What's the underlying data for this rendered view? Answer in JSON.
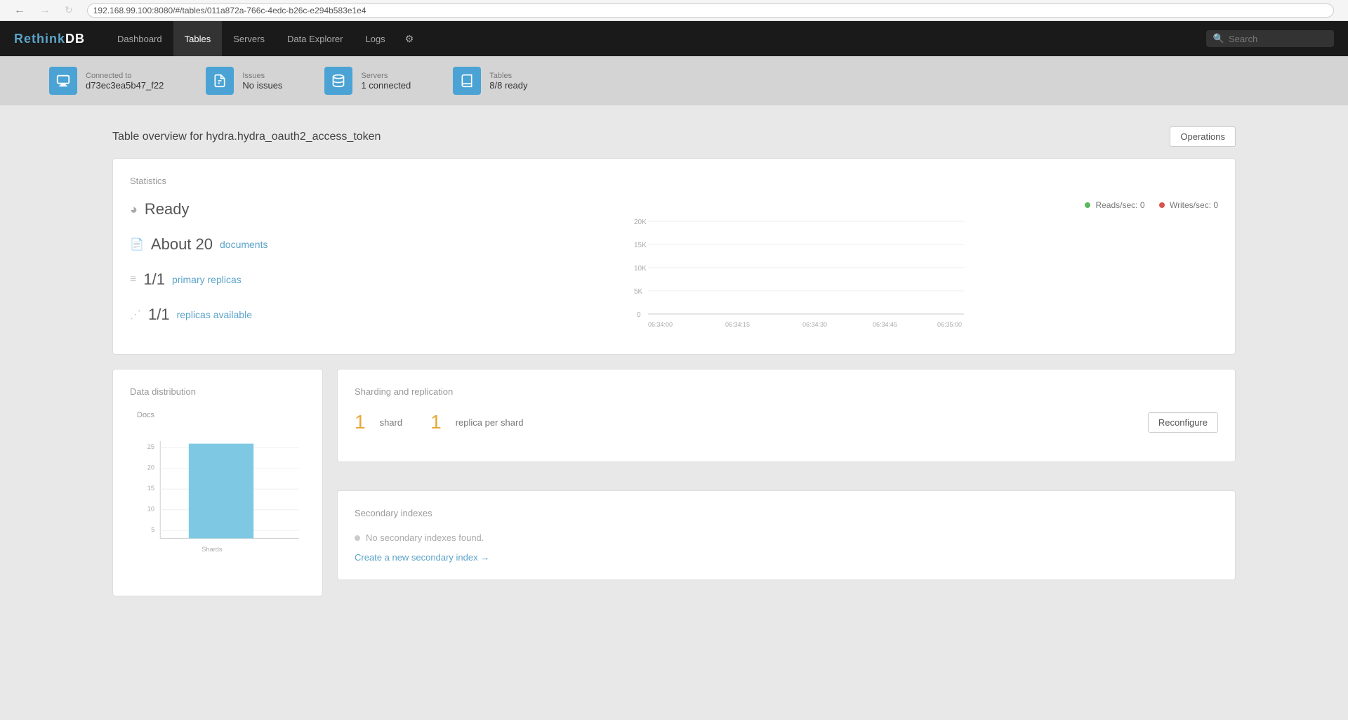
{
  "browser": {
    "url": "192.168.99.100:8080/#/tables/011a872a-766c-4edc-b26c-e294b583e1e4"
  },
  "navbar": {
    "brand": "RethinkDB",
    "links": [
      {
        "label": "Dashboard",
        "active": false
      },
      {
        "label": "Tables",
        "active": true
      },
      {
        "label": "Servers",
        "active": false
      },
      {
        "label": "Data Explorer",
        "active": false
      },
      {
        "label": "Logs",
        "active": false
      }
    ],
    "search_placeholder": "Search"
  },
  "statusbar": {
    "connected_to": {
      "label": "Connected to",
      "value": "d73ec3ea5b47_f22"
    },
    "issues": {
      "label": "Issues",
      "value": "No issues"
    },
    "servers": {
      "label": "Servers",
      "value": "1 connected"
    },
    "tables": {
      "label": "Tables",
      "value": "8/8 ready"
    }
  },
  "page": {
    "title": "Table overview for hydra.hydra_oauth2_access_token",
    "operations_label": "Operations"
  },
  "statistics": {
    "section_title": "Statistics",
    "status": "Ready",
    "documents_count": "About 20",
    "documents_link": "documents",
    "replicas": "1/1",
    "replicas_link": "primary replicas",
    "replicas_available": "1/1",
    "replicas_available_link": "replicas available",
    "chart": {
      "legend_reads": "Reads/sec: 0",
      "legend_writes": "Writes/sec: 0",
      "reads_color": "#5cb85c",
      "writes_color": "#d9534f",
      "y_labels": [
        "20K",
        "15K",
        "10K",
        "5K",
        "0"
      ],
      "x_labels": [
        "06:34:00",
        "06:34:15",
        "06:34:30",
        "06:34:45",
        "06:35:00"
      ]
    }
  },
  "data_distribution": {
    "title": "Data distribution",
    "y_label": "Docs",
    "y_ticks": [
      "25",
      "20",
      "15",
      "10",
      "5"
    ],
    "x_label": "Shards",
    "bar_color": "#7ec8e3",
    "bar_value": 27
  },
  "sharding": {
    "title": "Sharding and replication",
    "shard_count": "1",
    "shard_label": "shard",
    "replica_count": "1",
    "replica_label": "replica per shard",
    "reconfigure_label": "Reconfigure"
  },
  "secondary_indexes": {
    "title": "Secondary indexes",
    "no_indexes_text": "No secondary indexes found.",
    "create_link": "Create a new secondary index →"
  }
}
